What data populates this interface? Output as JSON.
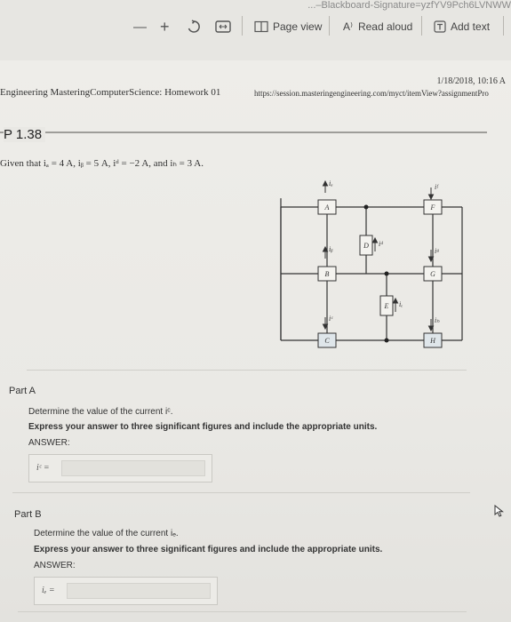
{
  "toolbar": {
    "url_fragment": "...–Blackboard-Signature=yzfYV9Pch6LVNWW",
    "minus_icon": "—",
    "plus_icon": "+",
    "page_view_label": "Page view",
    "read_aloud_label": "Read aloud",
    "add_text_label": "Add text",
    "read_aloud_icon": "A⁾"
  },
  "header": {
    "print_date": "1/18/2018, 10:16 A",
    "course_title": "Engineering MasteringComputerScience: Homework 01",
    "print_url": "https://session.masteringengineering.com/myct/itemView?assignmentPro"
  },
  "problem": {
    "title": "P 1.38",
    "given": "Given that iₐ = 4 A, iᵦ = 5 A, iᵈ = −2 A, and iₕ = 3 A."
  },
  "circuit": {
    "elements": [
      "A",
      "B",
      "C",
      "D",
      "E",
      "F",
      "G",
      "H"
    ],
    "currents": [
      "iₐ",
      "iᵦ",
      "iᶜ",
      "iᵈ",
      "iₑ",
      "iᶠ",
      "iᵍ",
      "iₕ"
    ]
  },
  "part_a": {
    "label": "Part A",
    "prompt": "Determine the value of the current iᶜ.",
    "instruction": "Express your answer to three significant figures and include the appropriate units.",
    "answer_label": "ANSWER:",
    "variable": "iᶜ ="
  },
  "part_b": {
    "label": "Part B",
    "prompt": "Determine the value of the current iₑ.",
    "instruction": "Express your answer to three significant figures and include the appropriate units.",
    "answer_label": "ANSWER:",
    "variable": "iₑ ="
  }
}
